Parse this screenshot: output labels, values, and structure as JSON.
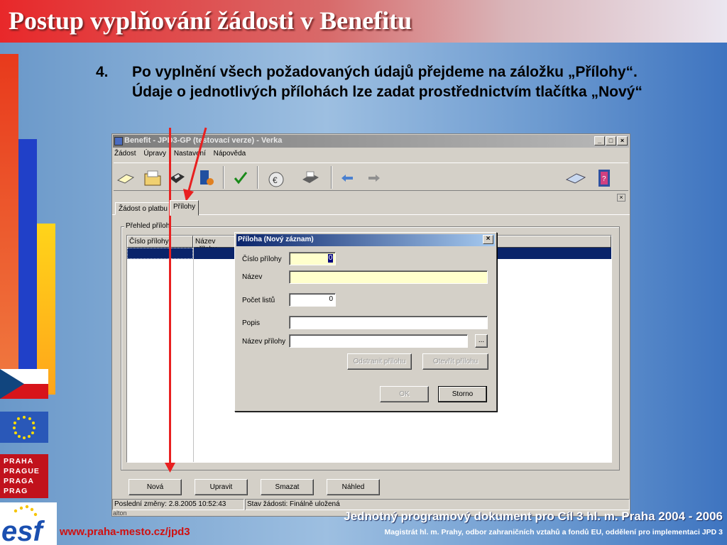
{
  "slide": {
    "title": "Postup vyplňování žádosti v Benefitu",
    "step_number": "4.",
    "step_text": "Po vyplnění všech požadovaných údajů přejdeme na záložku „Přílohy“. Údaje o jednotlivých přílohách lze zadat prostřednictvím tlačítka „Nový“",
    "footer_line1": "Jednotný programový dokument pro Cíl 3 hl. m. Praha 2004 - 2006",
    "footer_line2": "Magistrát hl. m. Prahy, odbor zahraničních vztahů a fondů EU, oddělení pro implementaci JPD 3",
    "url": "www.praha-mesto.cz/jpd3",
    "praha_logo": [
      "PRAHA",
      "PRAGUE",
      "PRAGA",
      "PRAG"
    ],
    "esf_logo": "esf"
  },
  "app": {
    "title": "Benefit - JPD3-GP (testovací verze) - Verka",
    "window_buttons": {
      "minimize": "_",
      "maximize": "□",
      "close": "×"
    },
    "menu": [
      "Žádost",
      "Úpravy",
      "Nastavení",
      "Nápověda"
    ],
    "tabs": [
      "Žádost o platbu",
      "Přílohy"
    ],
    "active_tab": "Přílohy",
    "tab_close": "×",
    "group_title": "Přehled příloh",
    "columns": [
      "Číslo přílohy",
      "Název přílohy"
    ],
    "buttons": {
      "new": "Nová",
      "edit": "Upravit",
      "delete": "Smazat",
      "preview": "Náhled"
    },
    "status": {
      "last_change": "Poslední změny: 2.8.2005 10:52:43",
      "state": "Stav žádosti: Finálně uložená",
      "partial": "alton"
    }
  },
  "dialog": {
    "title": "Příloha (Nový záznam)",
    "close": "×",
    "fields": {
      "number_label": "Číslo přílohy",
      "number_value": "0",
      "name_label": "Název",
      "name_value": "",
      "pages_label": "Počet listů",
      "pages_value": "0",
      "desc_label": "Popis",
      "desc_value": "",
      "filename_label": "Název přílohy",
      "filename_value": ""
    },
    "browse": "...",
    "buttons": {
      "remove": "Odstranit přílohu",
      "open": "Otevřít přílohu",
      "ok": "OK",
      "cancel": "Storno"
    }
  },
  "colors": {
    "accent_red": "#e82020",
    "selection": "#0a246a",
    "required_field": "#ffffcc"
  }
}
